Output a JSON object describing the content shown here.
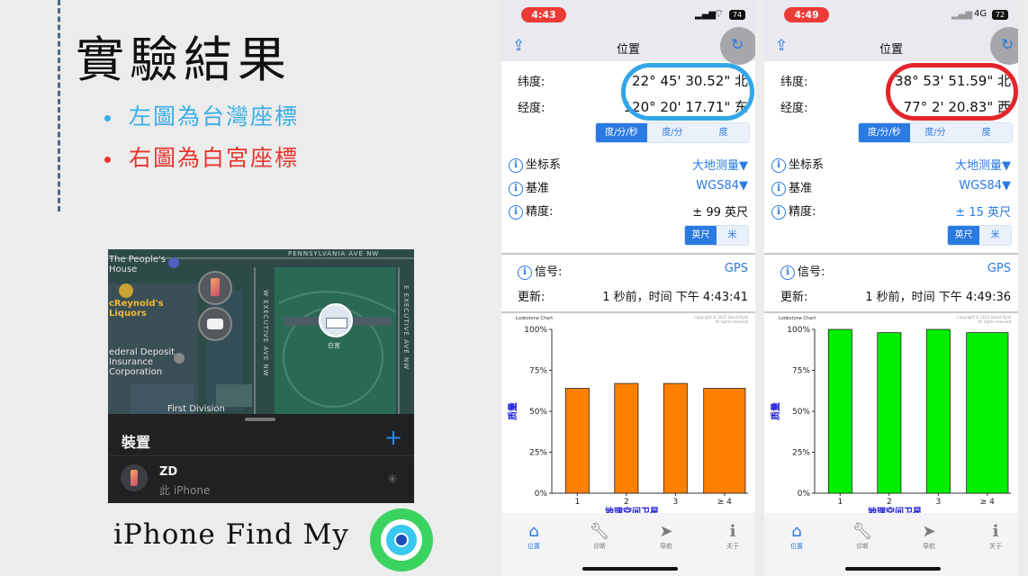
{
  "slide": {
    "title": "實驗結果",
    "bullet_left": "左圖為台灣座標",
    "bullet_right": "右圖為白宮座標",
    "caption": "iPhone Find My",
    "colors": {
      "bullet_left": "#3aaee7",
      "bullet_right": "#e8352e"
    }
  },
  "map": {
    "labels": {
      "peoples_house": "The People's\nHouse",
      "mcreynolds": "cReynold's\nLiquors",
      "federal": "ederal Deposit\nInsurance\nCorporation",
      "first_division": "First Division",
      "white_house": "白宮",
      "street_pennsylvania": "PENNSYLVANIA AVE NW",
      "street_w_exec": "W EXECUTIVE AVE NW",
      "street_e_exec": "E EXECUTIVE AVE NW"
    },
    "sheet": {
      "title": "裝置",
      "add": "+",
      "device_name": "ZD",
      "device_sub": "此 iPhone"
    }
  },
  "phones": [
    {
      "time": "4:43",
      "network": "",
      "battery": "74",
      "title": "位置",
      "lat_label": "纬度:",
      "lat_value": "22° 45' 30.52\" 北",
      "lon_label": "经度:",
      "lon_value": "120° 20' 17.71\" 东",
      "highlight_color": "#32a6e8",
      "format_seg": [
        "度/分/秒",
        "度/分",
        "度"
      ],
      "coord_sys_label": "坐标系",
      "coord_sys_value": "大地测量▼",
      "datum_label": "基准",
      "datum_value": "WGS84▼",
      "accuracy_label": "精度:",
      "accuracy_value": "± 99  英尺",
      "unit_seg": [
        "英尺",
        "米"
      ],
      "signal_label": "信号:",
      "signal_value": "GPS",
      "update_label": "更新:",
      "update_value": "1 秒前，时间 下午 4:43:41",
      "tabs": [
        "位置",
        "诊断",
        "导航",
        "关于"
      ]
    },
    {
      "time": "4:49",
      "network": "4G",
      "battery": "72",
      "title": "位置",
      "lat_label": "纬度:",
      "lat_value": "38° 53' 51.59\" 北",
      "lon_label": "经度:",
      "lon_value": "77° 2' 20.83\" 西",
      "highlight_color": "#e4242b",
      "format_seg": [
        "度/分/秒",
        "度/分",
        "度"
      ],
      "coord_sys_label": "坐标系",
      "coord_sys_value": "大地测量▼",
      "datum_label": "基准",
      "datum_value": "WGS84▼",
      "accuracy_label": "精度:",
      "accuracy_value": "± 15  英尺",
      "unit_seg": [
        "英尺",
        "米"
      ],
      "signal_label": "信号:",
      "signal_value": "GPS",
      "update_label": "更新:",
      "update_value": "1 秒前，时间 下午 4:49:36",
      "tabs": [
        "位置",
        "诊断",
        "导航",
        "关于"
      ]
    }
  ],
  "chart_data": [
    {
      "type": "bar",
      "title": "Lodestone Chart",
      "copyright": "Copyright © 2015 David Ryall\nAll rights reserved",
      "categories": [
        "1",
        "2",
        "3",
        "≥ 4"
      ],
      "values": [
        64,
        67,
        67,
        64
      ],
      "ylim": [
        0,
        100
      ],
      "yticks": [
        "100%",
        "75%",
        "50%",
        "25%",
        "0%"
      ],
      "xlabel": "地理空间卫星",
      "ylabel": "质量",
      "bar_color": "#ff7f00"
    },
    {
      "type": "bar",
      "title": "Lodestone Chart",
      "copyright": "Copyright © 2015 David Ryall\nAll rights reserved",
      "categories": [
        "1",
        "2",
        "3",
        "≥ 4"
      ],
      "values": [
        100,
        98,
        100,
        98
      ],
      "ylim": [
        0,
        100
      ],
      "yticks": [
        "100%",
        "75%",
        "50%",
        "25%",
        "0%"
      ],
      "xlabel": "地理空间卫星",
      "ylabel": "质量",
      "bar_color": "#00ee00"
    }
  ]
}
